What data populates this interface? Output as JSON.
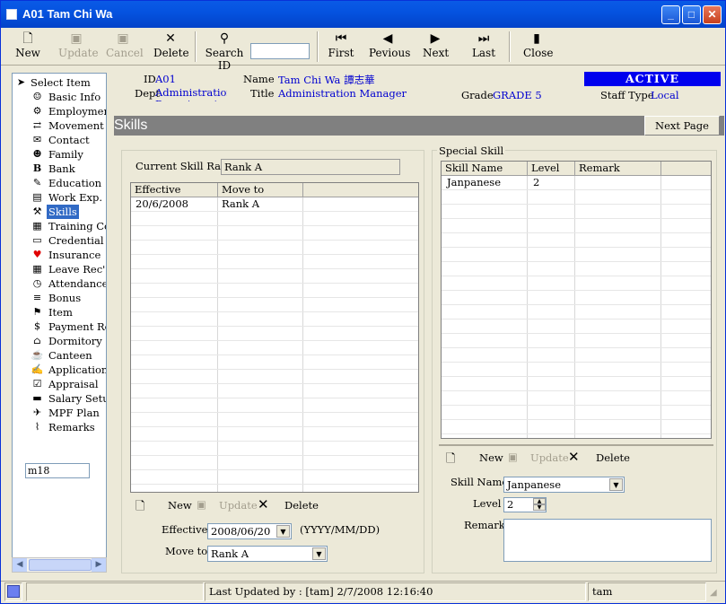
{
  "window": {
    "title": "A01 Tam Chi Wa"
  },
  "toolbar": {
    "new": "New",
    "update": "Update",
    "cancel": "Cancel",
    "delete": "Delete",
    "search_id": "Search ID",
    "first": "First",
    "previous": "Pevious",
    "next": "Next",
    "last": "Last",
    "close": "Close"
  },
  "tree": {
    "root": "Select Item",
    "items": [
      "Basic Info",
      "Employment",
      "Movement",
      "Contact",
      "Family",
      "Bank",
      "Education",
      "Work Exp.",
      "Skills",
      "Training Cou",
      "Credential",
      "Insurance",
      "Leave Rec'",
      "Attendance",
      "Bonus",
      "Item",
      "Payment Rec'",
      "Dormitory",
      "Canteen",
      "Application",
      "Appraisal",
      "Salary Setup",
      "MPF Plan",
      "Remarks"
    ],
    "selected": "Skills"
  },
  "left_input": {
    "value": "m18"
  },
  "info": {
    "id_label": "ID",
    "id_value": "A01",
    "name_label": "Name",
    "name_value": "Tam Chi Wa  譚志華",
    "dept_label": "Dept",
    "dept_value": "Administration Department",
    "title_label": "Title",
    "title_value": "Administration Manager",
    "grade_label": "Grade",
    "grade_value": "GRADE 5",
    "stafftype_label": "Staff Type",
    "stafftype_value": "Local",
    "status": "ACTIVE"
  },
  "section": {
    "title": "Skills",
    "next_page": "Next Page"
  },
  "skill_rank": {
    "current_label": "Current Skill Rank",
    "current_value": "Rank A",
    "columns": [
      "Effective",
      "Move to"
    ],
    "rows": [
      [
        "20/6/2008",
        "Rank A"
      ]
    ],
    "actions": {
      "new": "New",
      "update": "Update",
      "delete": "Delete"
    },
    "effective_label": "Effective",
    "effective_value": "2008/06/20",
    "date_hint": "(YYYY/MM/DD)",
    "moveto_label": "Move to",
    "moveto_value": "Rank A"
  },
  "special_skill": {
    "group_label": "Special Skill",
    "columns": [
      "Skill Name",
      "Level",
      "Remark"
    ],
    "rows": [
      [
        "Janpanese",
        "2",
        ""
      ]
    ],
    "actions": {
      "new": "New",
      "update": "Update",
      "delete": "Delete"
    },
    "skillname_label": "Skill Name",
    "skillname_value": "Janpanese",
    "level_label": "Level",
    "level_value": "2",
    "remark_label": "Remark"
  },
  "status": {
    "last_updated": "Last Updated by : [tam]  2/7/2008 12:16:40",
    "user": "tam"
  }
}
